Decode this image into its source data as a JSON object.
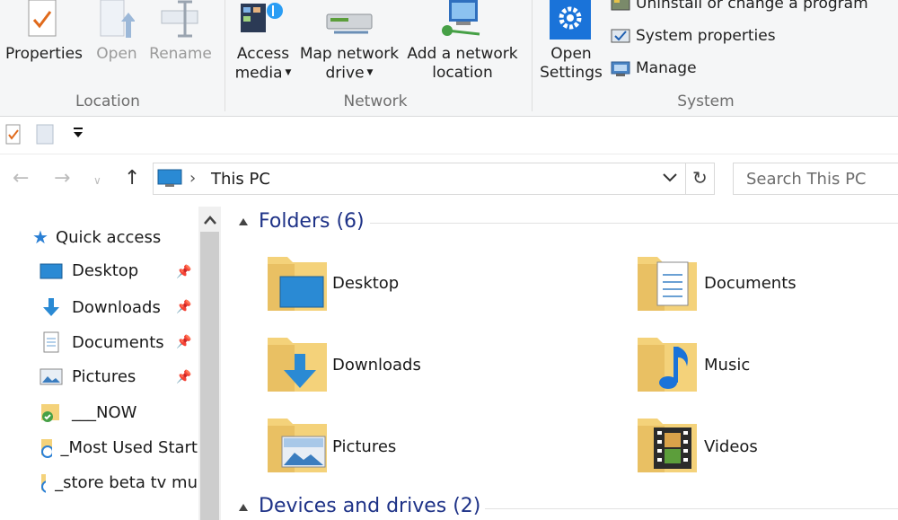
{
  "ribbon": {
    "location": {
      "properties": "Properties",
      "open": "Open",
      "rename": "Rename",
      "label": "Location"
    },
    "network": {
      "access_media_1": "Access",
      "access_media_2": "media",
      "map_drive_1": "Map network",
      "map_drive_2": "drive",
      "add_location_1": "Add a network",
      "add_location_2": "location",
      "label": "Network"
    },
    "system": {
      "open_settings_1": "Open",
      "open_settings_2": "Settings",
      "uninstall": "Uninstall or change a program",
      "system_properties": "System properties",
      "manage": "Manage",
      "label": "System"
    }
  },
  "address": {
    "path": "This PC",
    "search_placeholder": "Search This PC"
  },
  "nav": {
    "quick_access": "Quick access",
    "items": [
      {
        "label": "Desktop",
        "pinned": true
      },
      {
        "label": "Downloads",
        "pinned": true
      },
      {
        "label": "Documents",
        "pinned": true
      },
      {
        "label": "Pictures",
        "pinned": true
      },
      {
        "label": "___NOW",
        "pinned": false
      },
      {
        "label": "_Most Used Start",
        "pinned": false
      },
      {
        "label": "_store beta tv mu",
        "pinned": false
      }
    ]
  },
  "content": {
    "folders_title": "Folders (6)",
    "devices_title": "Devices and drives (2)",
    "folders": [
      "Desktop",
      "Documents",
      "Downloads",
      "Music",
      "Pictures",
      "Videos"
    ]
  },
  "colors": {
    "accent": "#1e3287",
    "folder": "#f4d27a",
    "settings_blue": "#1a73d9"
  }
}
